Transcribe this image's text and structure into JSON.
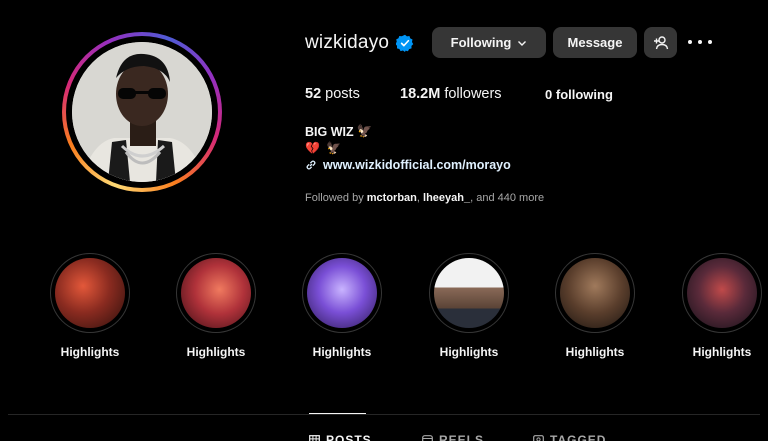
{
  "profile": {
    "username": "wizkidayo",
    "verified": true,
    "following_button": "Following",
    "message_button": "Message",
    "stats": {
      "posts_count": "52",
      "posts_label": "posts",
      "followers_count": "18.2M",
      "followers_label": "followers",
      "following_count": "0",
      "following_label": "following"
    },
    "bio": {
      "name": "BIG WIZ",
      "name_emoji": "🦅",
      "line2_emoji_a": "💔",
      "line2_emoji_b": "🦅",
      "link": "www.wizkidofficial.com/morayo"
    },
    "followed_by": {
      "prefix": "Followed by",
      "user1": "mctorban",
      "separator": ",",
      "user2": "lheeyah_",
      "suffix": "and 440 more"
    }
  },
  "highlights": [
    {
      "label": "Highlights"
    },
    {
      "label": "Highlights"
    },
    {
      "label": "Highlights"
    },
    {
      "label": "Highlights"
    },
    {
      "label": "Highlights"
    },
    {
      "label": "Highlights"
    }
  ],
  "tabs": {
    "posts": "POSTS",
    "reels": "REELS",
    "tagged": "TAGGED",
    "active": "posts"
  },
  "colors": {
    "background": "#000000",
    "button": "#363636",
    "verified": "#0095f6",
    "muted_text": "#a8a8a8"
  }
}
